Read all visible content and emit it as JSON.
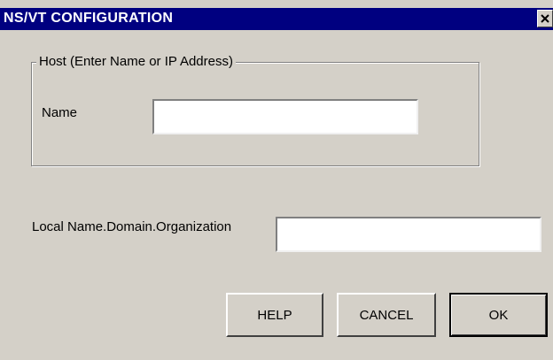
{
  "window": {
    "title": "NS/VT CONFIGURATION",
    "close_icon": "close-x-icon"
  },
  "host_group": {
    "legend": "Host (Enter Name or IP Address)",
    "name_label": "Name",
    "name_value": ""
  },
  "local_field": {
    "label": "Local Name.Domain.Organization",
    "value": ""
  },
  "buttons": {
    "help": "HELP",
    "cancel": "CANCEL",
    "ok": "OK"
  },
  "colors": {
    "titlebar": "#000080",
    "face": "#d4d0c8"
  }
}
